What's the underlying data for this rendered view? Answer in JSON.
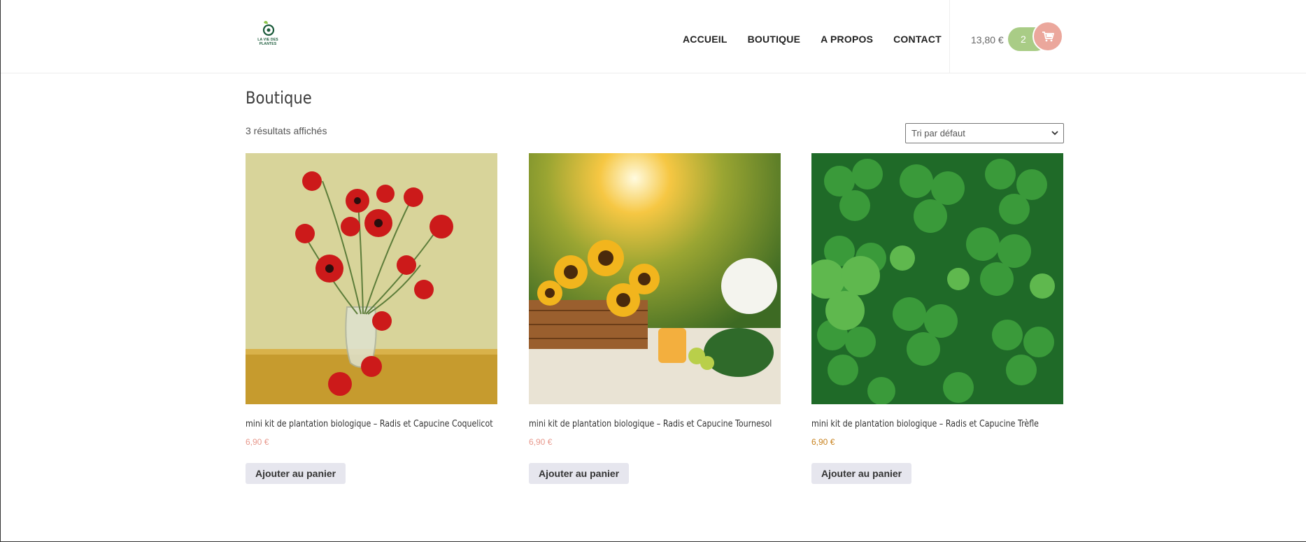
{
  "header": {
    "logo_text": "LA VIE DES PLANTES",
    "nav": [
      "ACCUEIL",
      "BOUTIQUE",
      "A PROPOS",
      "CONTACT"
    ],
    "cart_total": "13,80 €",
    "cart_count": "2"
  },
  "main": {
    "title": "Boutique",
    "results": "3 résultats affichés",
    "sort_selected": "Tri par défaut"
  },
  "products": [
    {
      "name": "mini kit de plantation biologique – Radis et Capucine Coquelicot",
      "price": "6,90 €",
      "button": "Ajouter au panier"
    },
    {
      "name": "mini kit de plantation biologique – Radis et Capucine Tournesol",
      "price": "6,90 €",
      "button": "Ajouter au panier"
    },
    {
      "name": "mini kit de plantation biologique – Radis et Capucine Trèfle",
      "price": "6,90 €",
      "button": "Ajouter au panier"
    }
  ],
  "colors": {
    "cart_count_bg": "#a9cc86",
    "cart_button_bg": "#eba79c",
    "price": "#e8998d",
    "price_alt": "#c8821e",
    "button_bg": "#e6e6ee"
  },
  "icons": [
    "leaf-logo-icon",
    "cart-icon",
    "chevron-down-icon"
  ]
}
